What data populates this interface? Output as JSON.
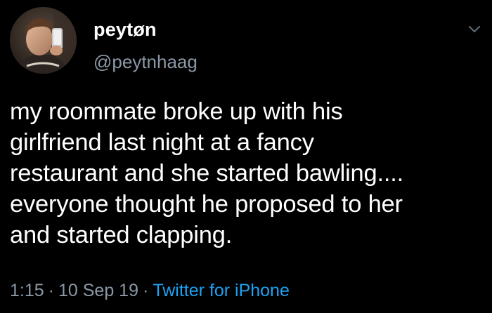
{
  "tweet": {
    "author": {
      "display_name": "peytøn",
      "handle": "@peytnhaag",
      "avatar_icon": "profile-photo"
    },
    "menu_icon": "chevron-down-icon",
    "text": "my roommate broke up with his\ngirlfriend last night at a fancy\nrestaurant and she started bawling....\neveryone thought he proposed to her\nand started clapping.",
    "meta": {
      "time": "1:15",
      "separator": "·",
      "date": "10 Sep 19",
      "source": "Twitter for iPhone"
    }
  },
  "colors": {
    "background": "#000000",
    "text": "#ffffff",
    "secondary": "#8b98a5",
    "link": "#1da1f2"
  }
}
